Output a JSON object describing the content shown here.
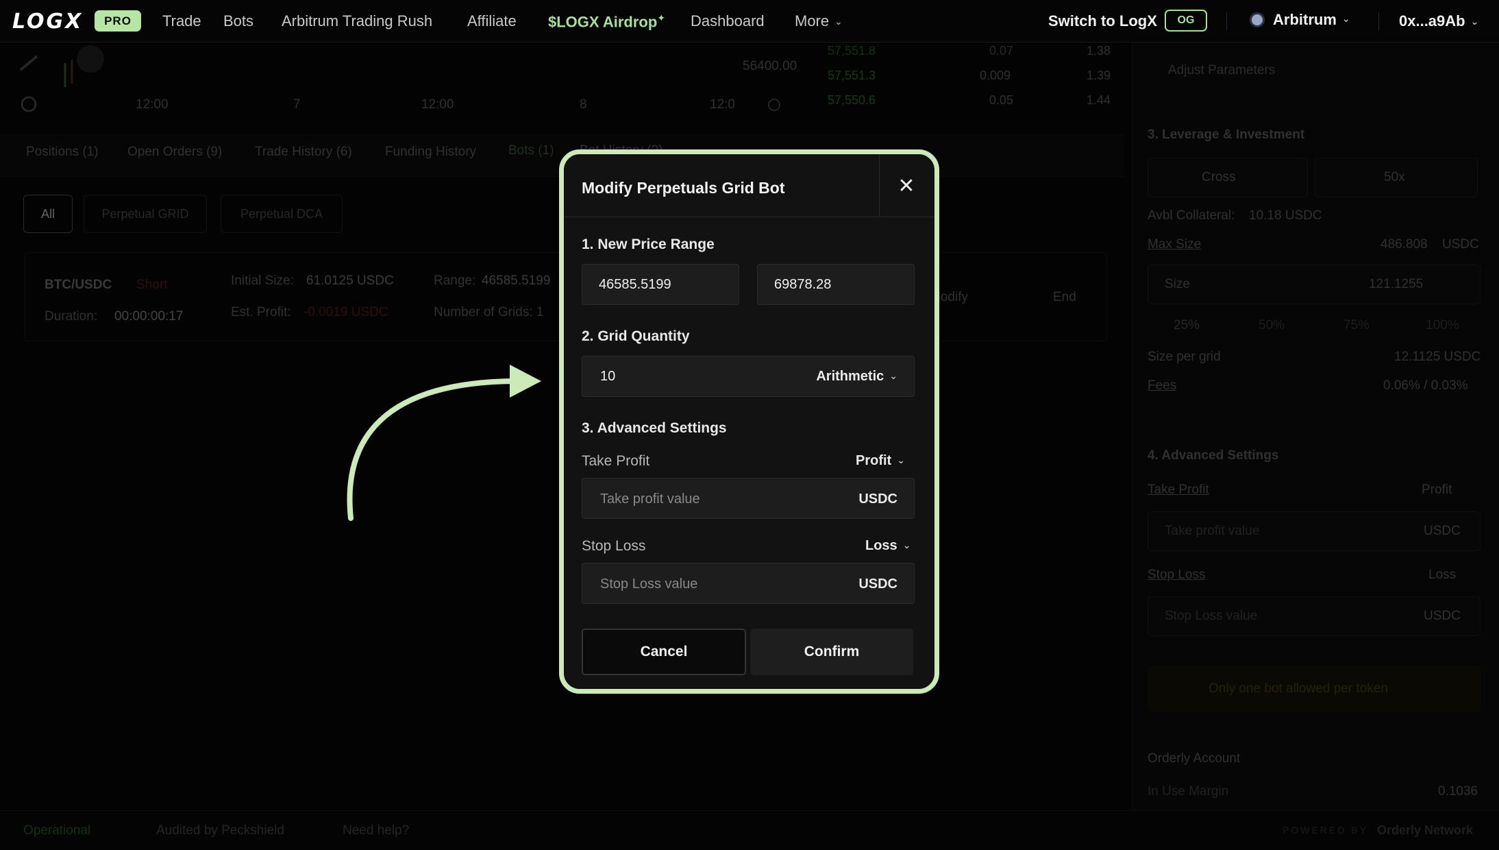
{
  "nav": {
    "logo": "LOGX",
    "pro_badge": "PRO",
    "items": [
      "Trade",
      "Bots",
      "Arbitrum Trading Rush",
      "Affiliate"
    ],
    "airdrop": "$LOGX Airdrop",
    "dashboard": "Dashboard",
    "more": "More",
    "switch_label": "Switch to LogX",
    "og_badge": "OG",
    "chain": "Arbitrum",
    "wallet": "0x...a9Ab"
  },
  "chart": {
    "time_labels": [
      "12:00",
      "7",
      "12:00",
      "8",
      "12:0"
    ],
    "price_label": "56400.00",
    "orderbook": [
      {
        "price": "57,551.8",
        "size": "0.07",
        "total": "1.38"
      },
      {
        "price": "57,551.3",
        "size": "0.009",
        "total": "1.39"
      },
      {
        "price": "57,550.6",
        "size": "0.05",
        "total": "1.44"
      }
    ]
  },
  "tabs": [
    "Positions (1)",
    "Open Orders (9)",
    "Trade History (6)",
    "Funding History",
    "Bots (1)",
    "Bot History (?)"
  ],
  "filters": [
    "All",
    "Perpetual GRID",
    "Perpetual DCA"
  ],
  "bot_row": {
    "pair": "BTC/USDC",
    "side": "Short",
    "duration_label": "Duration:",
    "duration_value": "00:00:00:17",
    "initial_size_label": "Initial Size:",
    "initial_size_value": "61.0125 USDC",
    "est_profit_label": "Est. Profit:",
    "est_profit_value": "-0.0019 USDC",
    "range_label": "Range:",
    "range_value": "46585.5199",
    "grids_label": "Number of Grids: 1",
    "modify": "Modify",
    "end": "End"
  },
  "right_panel": {
    "adjust": "Adjust Parameters",
    "leverage_title": "3. Leverage & Investment",
    "margin_mode": "Cross",
    "leverage": "50x",
    "avbl_label": "Avbl Collateral:",
    "avbl_value": "10.18 USDC",
    "max_size_label": "Max Size",
    "max_size_value": "486.808",
    "usdc": "USDC",
    "size_label": "Size",
    "size_value": "121.1255",
    "percents": [
      "25%",
      "50%",
      "75%",
      "100%"
    ],
    "size_per_grid_label": "Size per grid",
    "size_per_grid_value": "12.1125 USDC",
    "fees_label": "Fees",
    "fees_value": "0.06% / 0.03%",
    "adv_title": "4. Advanced Settings",
    "take_profit": "Take Profit",
    "profit": "Profit",
    "take_profit_ph": "Take profit value",
    "stop_loss": "Stop Loss",
    "loss": "Loss",
    "stop_loss_ph": "Stop Loss value",
    "notice": "Only one bot allowed per token",
    "account_title": "Orderly Account",
    "margin_label": "In Use Margin",
    "margin_value": "0.1036",
    "powered": "POWERED BY",
    "powered_name": "Orderly Network"
  },
  "footer": {
    "status": "Operational",
    "audit": "Audited by Peckshield",
    "help": "Need help?"
  },
  "modal": {
    "title": "Modify Perpetuals Grid Bot",
    "section1": "1. New Price Range",
    "price_low": "46585.5199",
    "price_high": "69878.28",
    "section2": "2. Grid Quantity",
    "grid_qty": "10",
    "grid_mode": "Arithmetic",
    "section3": "3. Advanced Settings",
    "tp_label": "Take Profit",
    "tp_select": "Profit",
    "tp_placeholder": "Take profit value",
    "tp_unit": "USDC",
    "sl_label": "Stop Loss",
    "sl_select": "Loss",
    "sl_placeholder": "Stop Loss value",
    "sl_unit": "USDC",
    "cancel": "Cancel",
    "confirm": "Confirm"
  },
  "colors": {
    "accent": "#a8e09a",
    "highlight_frame": "#cbeab8",
    "background": "#050505"
  }
}
